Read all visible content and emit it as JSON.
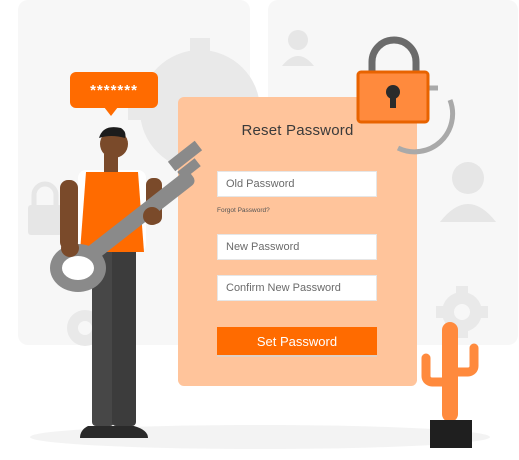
{
  "speech_bubble": {
    "text": "*******"
  },
  "form": {
    "title": "Reset Password",
    "old_password_placeholder": "Old Password",
    "forgot_link": "Forgot Password?",
    "new_password_placeholder": "New Password",
    "confirm_password_placeholder": "Confirm New Password",
    "submit_label": "Set Password"
  },
  "icons": [
    "gear-icon",
    "user-icon",
    "padlock-icon",
    "refresh-arrows-icon",
    "key-icon",
    "cactus-icon"
  ],
  "colors": {
    "accent": "#ff6b00",
    "panel": "#ffc49b",
    "background_shapes": "#f7f7f7",
    "gray_shapes": "#e6e6e6",
    "key": "#7a7a7a"
  }
}
